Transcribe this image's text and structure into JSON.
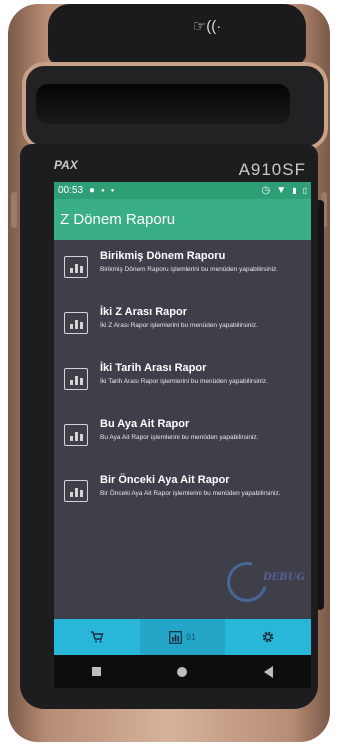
{
  "device": {
    "brand": "PAX",
    "model": "A910SF",
    "nfc_symbol": "☞((·"
  },
  "statusbar": {
    "time": "00:53",
    "left_icons": [
      "message-icon",
      "dot-icon",
      "dot-icon"
    ],
    "right_icons": [
      "alarm-icon",
      "wifi-icon",
      "signal-icon",
      "battery-icon"
    ]
  },
  "appbar": {
    "title": "Z Dönem Raporu"
  },
  "menu": {
    "items": [
      {
        "title": "Birikmiş Dönem Raporu",
        "desc": "Birikmiş Dönem Raporu işlemlerini bu menüden yapabilirsiniz.",
        "icon": "bar-chart-icon"
      },
      {
        "title": "İki Z Arası Rapor",
        "desc": "İki Z Arası Rapor işlemlerini bu menüden yapabilirsiniz.",
        "icon": "bar-chart-icon"
      },
      {
        "title": "İki Tarih Arası Rapor",
        "desc": "İki Tarih Arası Rapor işlemlerini bu menüden yapabilirsiniz.",
        "icon": "bar-chart-icon"
      },
      {
        "title": "Bu Aya Ait Rapor",
        "desc": "Bu Aya Ait Rapor işlemlerini bu menüden yapabilirsiniz.",
        "icon": "bar-chart-icon"
      },
      {
        "title": "Bir Önceki Aya Ait Rapor",
        "desc": "Bir Önceki Aya Ait Rapor işlemlerini bu menüden yapabilirsiniz.",
        "icon": "bar-chart-icon"
      }
    ]
  },
  "watermark": {
    "text": "DEBUG"
  },
  "tabbar": {
    "tabs": [
      {
        "icon": "cart-icon",
        "label": ""
      },
      {
        "icon": "bar-chart-icon",
        "label": "91"
      },
      {
        "icon": "gear-icon",
        "label": ""
      }
    ],
    "active_index": 1
  },
  "colors": {
    "appbar": "#3aae84",
    "statusbar": "#2e9e75",
    "screen_bg": "#3f3f4a",
    "tabbar": "#29b7d9"
  }
}
